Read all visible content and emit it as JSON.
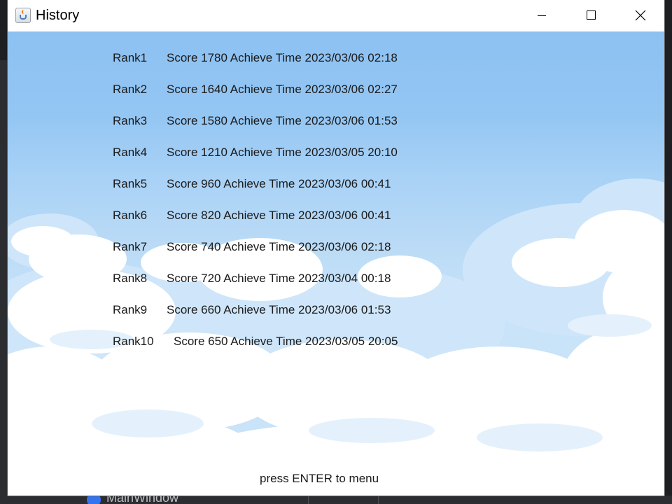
{
  "window": {
    "title": "History",
    "icon": "java-cup-icon",
    "controls": {
      "minimize": "minimize-icon",
      "maximize": "maximize-icon",
      "close": "close-icon"
    }
  },
  "background_ide": {
    "bottom_label": "MainWindow"
  },
  "ranks": [
    {
      "rank": "Rank1",
      "info": "Score 1780 Achieve Time 2023/03/06 02:18"
    },
    {
      "rank": "Rank2",
      "info": "Score 1640 Achieve Time 2023/03/06 02:27"
    },
    {
      "rank": "Rank3",
      "info": "Score 1580 Achieve Time 2023/03/06 01:53"
    },
    {
      "rank": "Rank4",
      "info": "Score 1210 Achieve Time 2023/03/05 20:10"
    },
    {
      "rank": "Rank5",
      "info": "Score 960 Achieve Time 2023/03/06 00:41"
    },
    {
      "rank": "Rank6",
      "info": "Score 820 Achieve Time 2023/03/06 00:41"
    },
    {
      "rank": "Rank7",
      "info": "Score 740 Achieve Time 2023/03/06 02:18"
    },
    {
      "rank": "Rank8",
      "info": "Score 720 Achieve Time 2023/03/04 00:18"
    },
    {
      "rank": "Rank9",
      "info": "Score 660 Achieve Time 2023/03/06 01:53"
    },
    {
      "rank": "Rank10",
      "info": "Score 650 Achieve Time 2023/03/05 20:05"
    }
  ],
  "footer": {
    "hint": "press ENTER to menu"
  },
  "colors": {
    "sky_top": "#8cc1f2",
    "sky_bottom": "#c9e3f8",
    "cloud": "#ffffff",
    "text": "#1a1a1a"
  }
}
